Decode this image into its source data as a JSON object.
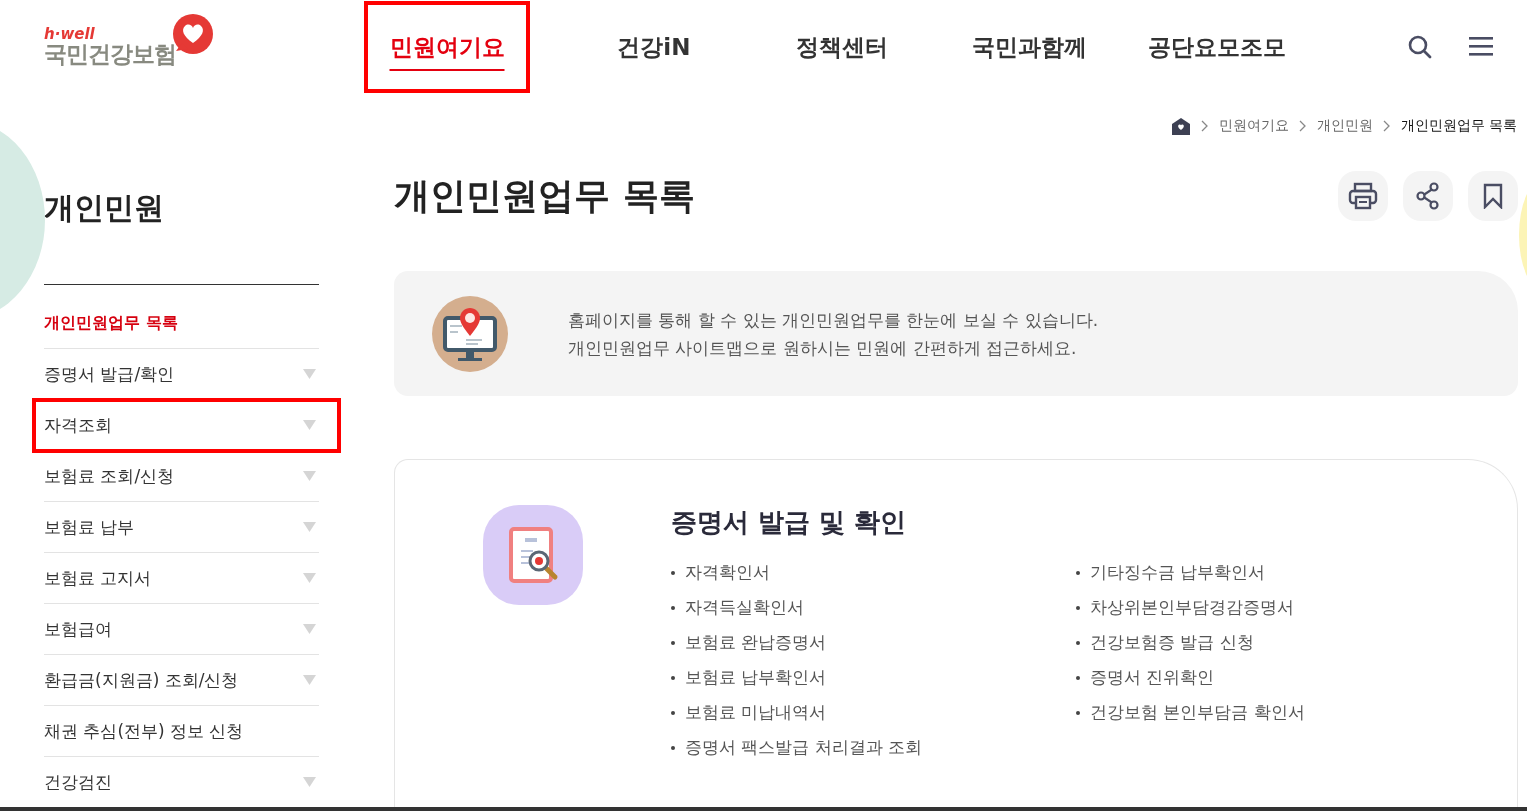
{
  "logo": {
    "tagline": "h·well",
    "name": "국민건강보험"
  },
  "nav": [
    {
      "label": "민원여기요",
      "selected": true,
      "highlighted": true
    },
    {
      "label": "건강iN",
      "selected": false,
      "highlighted": false
    },
    {
      "label": "정책센터",
      "selected": false,
      "highlighted": false
    },
    {
      "label": "국민과함께",
      "selected": false,
      "highlighted": false
    },
    {
      "label": "공단요모조모",
      "selected": false,
      "highlighted": false
    }
  ],
  "breadcrumb": [
    "민원여기요",
    "개인민원",
    "개인민원업무 목록"
  ],
  "sidebar": {
    "title": "개인민원",
    "items": [
      {
        "label": "개인민원업무 목록",
        "selected": true,
        "has_submenu": false,
        "highlighted": false
      },
      {
        "label": "증명서 발급/확인",
        "selected": false,
        "has_submenu": true,
        "highlighted": false
      },
      {
        "label": "자격조회",
        "selected": false,
        "has_submenu": true,
        "highlighted": true
      },
      {
        "label": "보험료 조회/신청",
        "selected": false,
        "has_submenu": true,
        "highlighted": false
      },
      {
        "label": "보험료 납부",
        "selected": false,
        "has_submenu": true,
        "highlighted": false
      },
      {
        "label": "보험료 고지서",
        "selected": false,
        "has_submenu": true,
        "highlighted": false
      },
      {
        "label": "보험급여",
        "selected": false,
        "has_submenu": true,
        "highlighted": false
      },
      {
        "label": "환급금(지원금) 조회/신청",
        "selected": false,
        "has_submenu": true,
        "highlighted": false
      },
      {
        "label": "채권 추심(전부) 정보 신청",
        "selected": false,
        "has_submenu": false,
        "highlighted": false
      },
      {
        "label": "건강검진",
        "selected": false,
        "has_submenu": true,
        "highlighted": false
      }
    ]
  },
  "page_title": "개인민원업무 목록",
  "intro": [
    "홈페이지를 통해 할 수 있는 개인민원업무를 한눈에 보실 수 있습니다.",
    "개인민원업무 사이트맵으로 원하시는 민원에 간편하게 접근하세요."
  ],
  "section": {
    "title": "증명서 발급 및 확인",
    "left_items": [
      "자격확인서",
      "자격득실확인서",
      "보험료 완납증명서",
      "보험료 납부확인서",
      "보험료 미납내역서",
      "증명서 팩스발급 처리결과 조회"
    ],
    "right_items": [
      "기타징수금 납부확인서",
      "차상위본인부담경감증명서",
      "건강보험증 발급 신청",
      "증명서 진위확인",
      "건강보험 본인부담금 확인서"
    ]
  }
}
